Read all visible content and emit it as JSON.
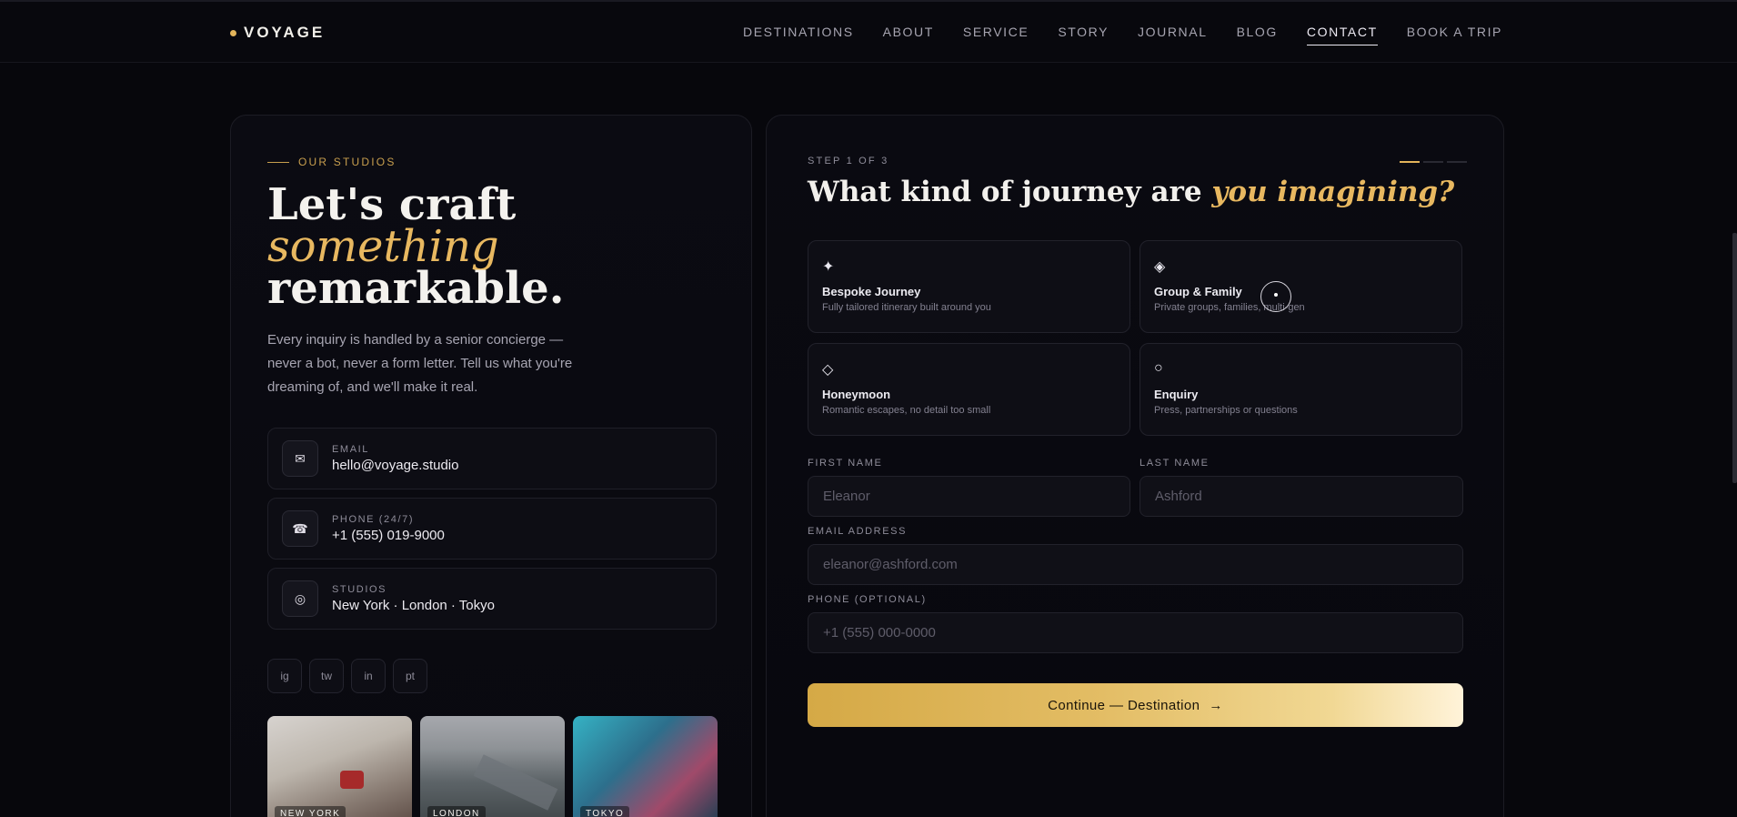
{
  "nav": {
    "logo": "VOYAGE",
    "links": [
      "DESTINATIONS",
      "ABOUT",
      "SERVICE",
      "STORY",
      "JOURNAL",
      "BLOG",
      "CONTACT",
      "BOOK A TRIP"
    ],
    "active": "CONTACT"
  },
  "studio": {
    "eyebrow": "OUR STUDIOS",
    "title_line1": "Let's craft",
    "title_line2": "something",
    "title_line3": "remarkable.",
    "description": "Every inquiry is handled by a senior concierge — never a bot, never a form letter. Tell us what you're dreaming of, and we'll make it real.",
    "contacts": [
      {
        "icon": "mail-icon",
        "glyph": "✉",
        "label": "EMAIL",
        "value": "hello@voyage.studio"
      },
      {
        "icon": "phone-icon",
        "glyph": "☎",
        "label": "PHONE (24/7)",
        "value": "+1 (555) 019-9000"
      },
      {
        "icon": "location-icon",
        "glyph": "◎",
        "label": "STUDIOS",
        "value": "New York · London · Tokyo"
      }
    ],
    "socials": [
      "ig",
      "tw",
      "in",
      "pt"
    ],
    "cities": [
      "NEW YORK",
      "LONDON",
      "TOKYO"
    ]
  },
  "form": {
    "step": "STEP 1 OF 3",
    "title_main": "What kind of journey are ",
    "title_accent": "you imagining?",
    "options": [
      {
        "icon": "sparkle-icon",
        "glyph": "✦",
        "title": "Bespoke Journey",
        "subtitle": "Fully tailored itinerary built around you"
      },
      {
        "icon": "diamond-filled-icon",
        "glyph": "◈",
        "title": "Group & Family",
        "subtitle": "Private groups, families, multi-gen"
      },
      {
        "icon": "diamond-outline-icon",
        "glyph": "◇",
        "title": "Honeymoon",
        "subtitle": "Romantic escapes, no detail too small"
      },
      {
        "icon": "circle-icon",
        "glyph": "○",
        "title": "Enquiry",
        "subtitle": "Press, partnerships or questions"
      }
    ],
    "first_name": {
      "label": "FIRST NAME",
      "placeholder": "Eleanor"
    },
    "last_name": {
      "label": "LAST NAME",
      "placeholder": "Ashford"
    },
    "email": {
      "label": "EMAIL ADDRESS",
      "placeholder": "eleanor@ashford.com"
    },
    "phone": {
      "label": "PHONE (OPTIONAL)",
      "placeholder": "+1 (555) 000-0000"
    },
    "cta": "Continue — Destination",
    "cta_arrow": "→"
  },
  "colors": {
    "accent": "#e3b45a",
    "background": "#07070c"
  }
}
